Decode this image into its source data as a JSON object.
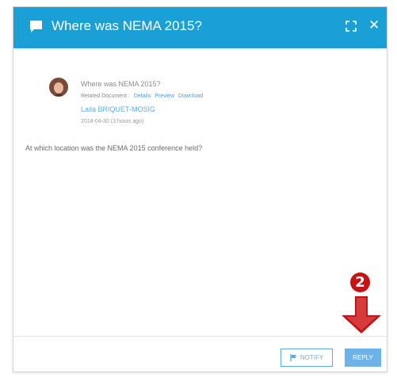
{
  "dialog": {
    "title": "Where was NEMA 2015?",
    "header_color": "#1ba0d6"
  },
  "message": {
    "title": "Where was NEMA 2015?",
    "related_label": "Related Document :",
    "links": [
      "Details",
      "Preview",
      "Download"
    ],
    "author": "Laila BRIQUET-MOSIG",
    "date": "2018-04-30 (3 hours ago)",
    "body": "At which location was the NEMA 2015 conference held?"
  },
  "footer": {
    "notify_label": "NOTIFY",
    "reply_label": "REPLY"
  },
  "annotation": {
    "step_number": "2",
    "color": "#c41414"
  }
}
